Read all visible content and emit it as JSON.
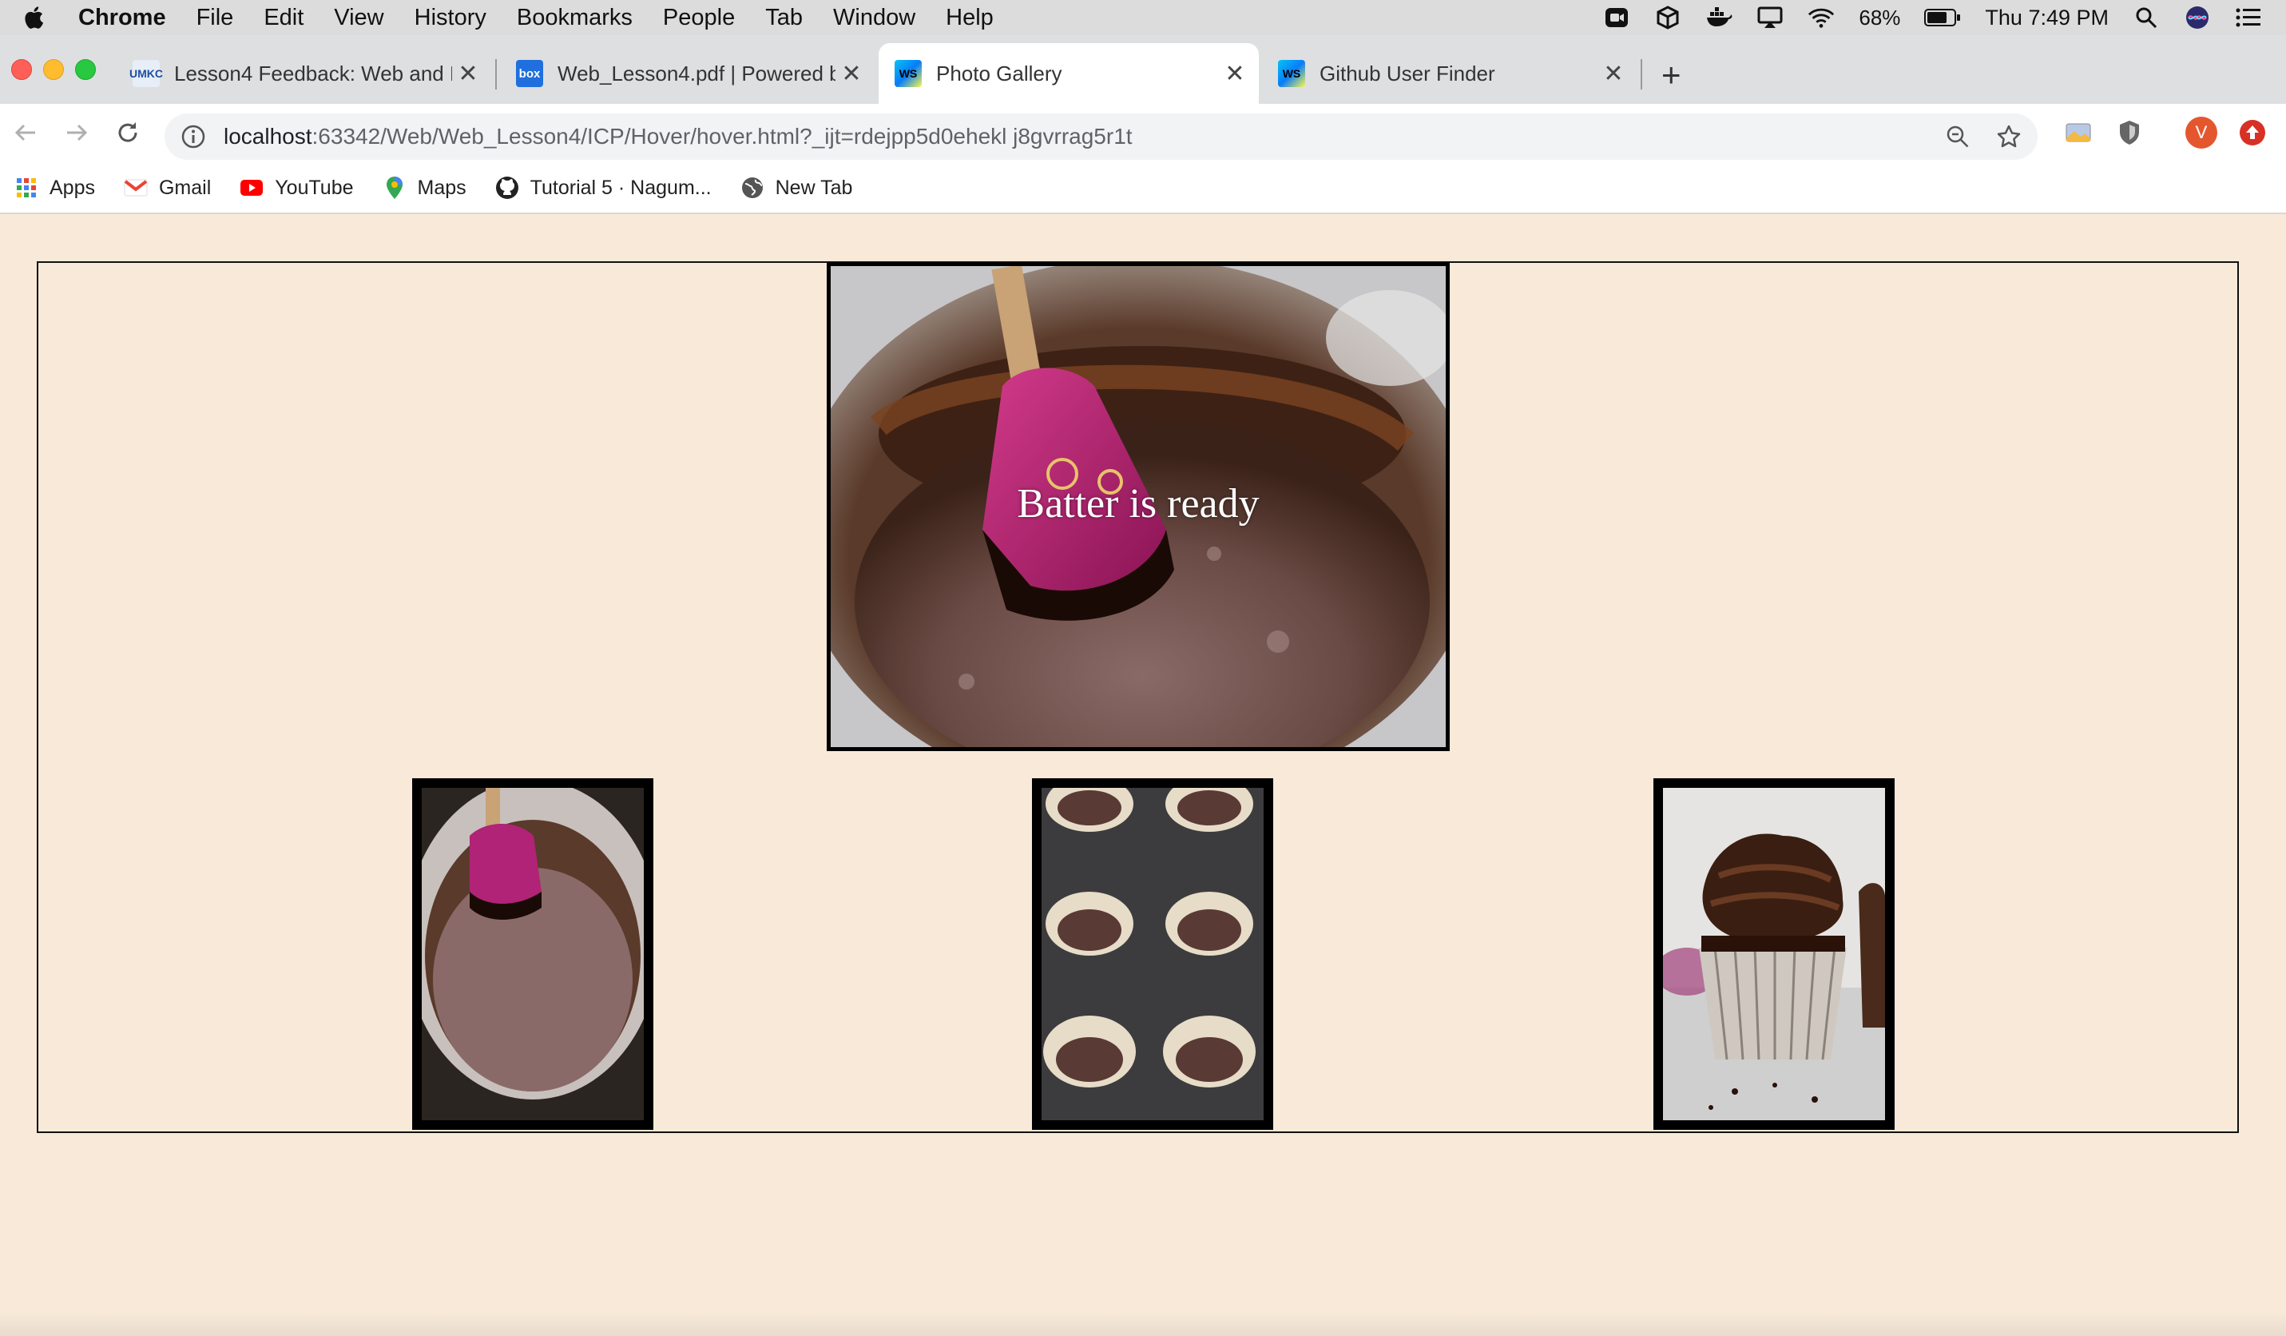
{
  "menubar": {
    "app_name": "Chrome",
    "items": [
      "File",
      "Edit",
      "View",
      "History",
      "Bookmarks",
      "People",
      "Tab",
      "Window",
      "Help"
    ],
    "battery": "68%",
    "clock": "Thu 7:49 PM"
  },
  "tabs": [
    {
      "title": "Lesson4 Feedback: Web and M",
      "favicon": "umkc-icon",
      "active": false
    },
    {
      "title": "Web_Lesson4.pdf | Powered by",
      "favicon": "box-icon",
      "active": false
    },
    {
      "title": "Photo Gallery",
      "favicon": "webstorm-icon",
      "active": true
    },
    {
      "title": "Github User Finder",
      "favicon": "webstorm-icon",
      "active": false
    }
  ],
  "tab_favicon_text": {
    "box": "box",
    "ws": "WS"
  },
  "address_bar": {
    "host": "localhost",
    "path": ":63342/Web/Web_Lesson4/ICP/Hover/hover.html?_ijt=rdejpp5d0ehekl j8gvrrag5r1t"
  },
  "profile_initial": "V",
  "bookmarks": [
    "Apps",
    "Gmail",
    "YouTube",
    "Maps",
    "Tutorial 5 · Nagum...",
    "New Tab"
  ],
  "gallery": {
    "main_caption": "Batter is ready",
    "thumbnails": [
      "chocolate-batter-bowl",
      "cupcake-liners-batter",
      "frosted-cupcake"
    ]
  },
  "colors": {
    "page_bg": "#f8e9d8",
    "tab_strip": "#dedfe1",
    "frame": "#000000"
  }
}
